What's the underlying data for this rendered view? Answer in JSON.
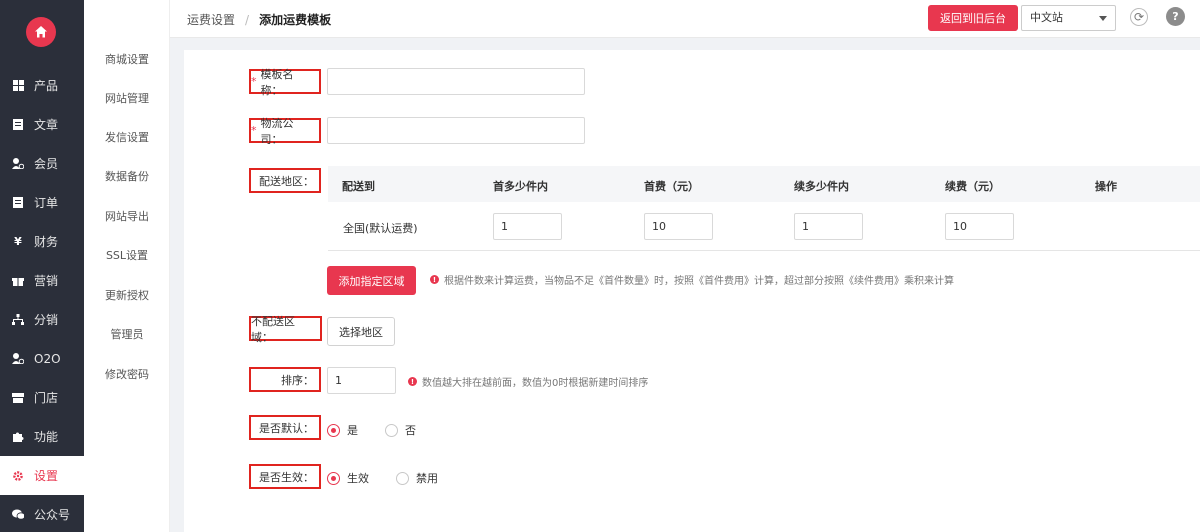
{
  "nav": {
    "items": [
      {
        "label": "产品",
        "icon": "grid-icon"
      },
      {
        "label": "文章",
        "icon": "document-icon"
      },
      {
        "label": "会员",
        "icon": "user-icon"
      },
      {
        "label": "订单",
        "icon": "order-icon"
      },
      {
        "label": "财务",
        "icon": "yen-icon"
      },
      {
        "label": "营销",
        "icon": "gift-icon"
      },
      {
        "label": "分销",
        "icon": "sitemap-icon"
      },
      {
        "label": "O2O",
        "icon": "users-icon"
      },
      {
        "label": "门店",
        "icon": "store-icon"
      },
      {
        "label": "功能",
        "icon": "puzzle-icon"
      },
      {
        "label": "设置",
        "icon": "gear-icon",
        "active": true
      },
      {
        "label": "公众号",
        "icon": "wechat-icon"
      }
    ]
  },
  "subnav": {
    "items": [
      "商城设置",
      "网站管理",
      "发信设置",
      "数据备份",
      "网站导出",
      "SSL设置",
      "更新授权",
      "管理员",
      "修改密码"
    ]
  },
  "header": {
    "crumb_parent": "运费设置",
    "crumb_sep": "/",
    "crumb_current": "添加运费模板",
    "back_button": "返回到旧后台",
    "lang_selected": "中文站",
    "help_glyph": "?"
  },
  "form": {
    "template_name_label": "模板名称：",
    "template_name_value": "",
    "logistics_label": "物流公司：",
    "logistics_value": "",
    "region_label": "配送地区：",
    "table_headers": [
      "配送到",
      "首多少件内",
      "首费（元）",
      "续多少件内",
      "续费（元）",
      "操作"
    ],
    "row": {
      "region": "全国(默认运费)",
      "first_qty": "1",
      "first_fee": "10",
      "next_qty": "1",
      "next_fee": "10"
    },
    "add_region_button": "添加指定区域",
    "calc_tip": "根据件数来计算运费，当物品不足《首件数量》时，按照《首件费用》计算，超过部分按照《续件费用》乘积来计算",
    "no_delivery_label": "不配送区域：",
    "select_region_button": "选择地区",
    "sort_label": "排序：",
    "sort_value": "1",
    "sort_tip": "数值越大排在越前面，数值为0时根据新建时间排序",
    "default_label": "是否默认：",
    "default_yes": "是",
    "default_no": "否",
    "active_label": "是否生效：",
    "active_yes": "生效",
    "active_no": "禁用"
  },
  "colors": {
    "accent": "#e8374f",
    "nav_bg": "#2b2f3a",
    "highlight_box": "#e0241f"
  }
}
